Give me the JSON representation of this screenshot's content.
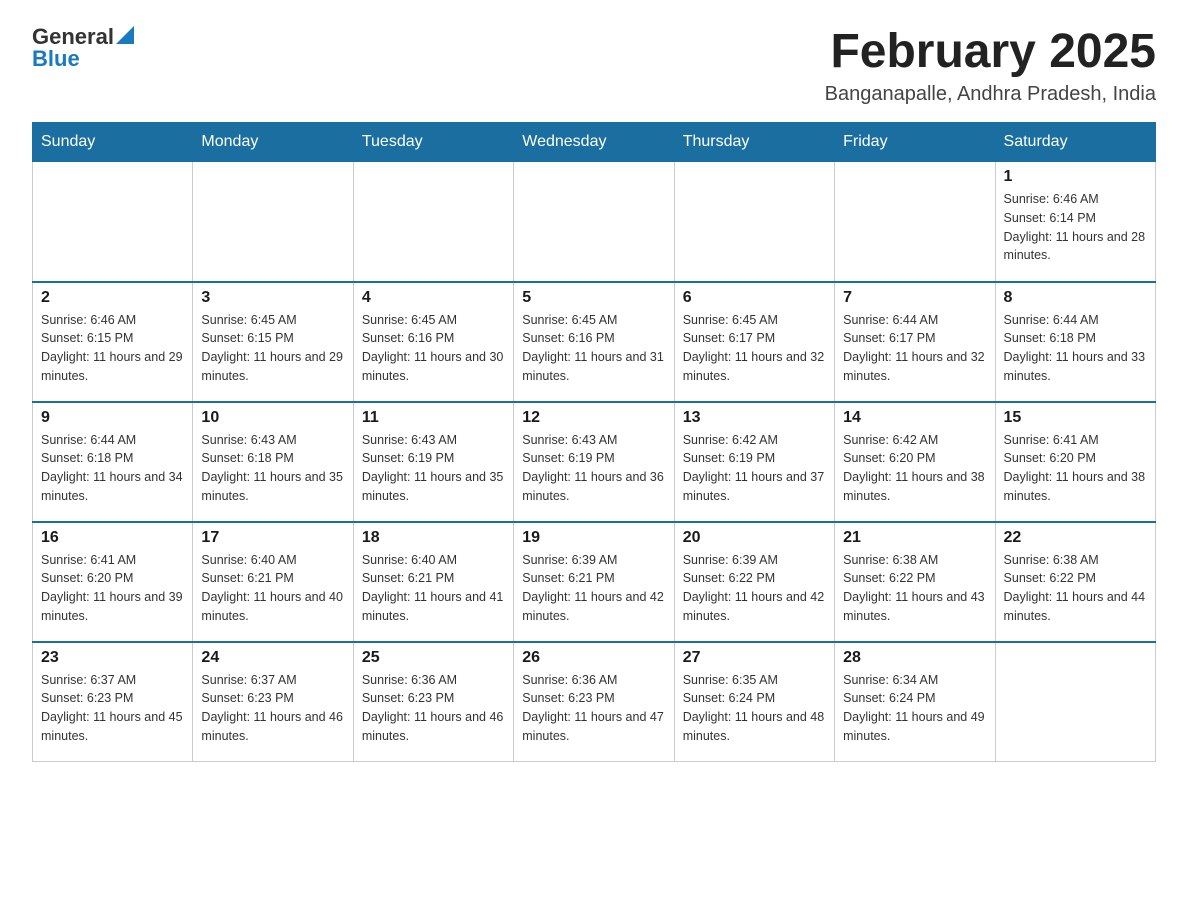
{
  "header": {
    "logo": {
      "general": "General",
      "blue": "Blue"
    },
    "title": "February 2025",
    "subtitle": "Banganapalle, Andhra Pradesh, India"
  },
  "weekdays": [
    "Sunday",
    "Monday",
    "Tuesday",
    "Wednesday",
    "Thursday",
    "Friday",
    "Saturday"
  ],
  "weeks": [
    [
      {
        "day": "",
        "info": ""
      },
      {
        "day": "",
        "info": ""
      },
      {
        "day": "",
        "info": ""
      },
      {
        "day": "",
        "info": ""
      },
      {
        "day": "",
        "info": ""
      },
      {
        "day": "",
        "info": ""
      },
      {
        "day": "1",
        "info": "Sunrise: 6:46 AM\nSunset: 6:14 PM\nDaylight: 11 hours and 28 minutes."
      }
    ],
    [
      {
        "day": "2",
        "info": "Sunrise: 6:46 AM\nSunset: 6:15 PM\nDaylight: 11 hours and 29 minutes."
      },
      {
        "day": "3",
        "info": "Sunrise: 6:45 AM\nSunset: 6:15 PM\nDaylight: 11 hours and 29 minutes."
      },
      {
        "day": "4",
        "info": "Sunrise: 6:45 AM\nSunset: 6:16 PM\nDaylight: 11 hours and 30 minutes."
      },
      {
        "day": "5",
        "info": "Sunrise: 6:45 AM\nSunset: 6:16 PM\nDaylight: 11 hours and 31 minutes."
      },
      {
        "day": "6",
        "info": "Sunrise: 6:45 AM\nSunset: 6:17 PM\nDaylight: 11 hours and 32 minutes."
      },
      {
        "day": "7",
        "info": "Sunrise: 6:44 AM\nSunset: 6:17 PM\nDaylight: 11 hours and 32 minutes."
      },
      {
        "day": "8",
        "info": "Sunrise: 6:44 AM\nSunset: 6:18 PM\nDaylight: 11 hours and 33 minutes."
      }
    ],
    [
      {
        "day": "9",
        "info": "Sunrise: 6:44 AM\nSunset: 6:18 PM\nDaylight: 11 hours and 34 minutes."
      },
      {
        "day": "10",
        "info": "Sunrise: 6:43 AM\nSunset: 6:18 PM\nDaylight: 11 hours and 35 minutes."
      },
      {
        "day": "11",
        "info": "Sunrise: 6:43 AM\nSunset: 6:19 PM\nDaylight: 11 hours and 35 minutes."
      },
      {
        "day": "12",
        "info": "Sunrise: 6:43 AM\nSunset: 6:19 PM\nDaylight: 11 hours and 36 minutes."
      },
      {
        "day": "13",
        "info": "Sunrise: 6:42 AM\nSunset: 6:19 PM\nDaylight: 11 hours and 37 minutes."
      },
      {
        "day": "14",
        "info": "Sunrise: 6:42 AM\nSunset: 6:20 PM\nDaylight: 11 hours and 38 minutes."
      },
      {
        "day": "15",
        "info": "Sunrise: 6:41 AM\nSunset: 6:20 PM\nDaylight: 11 hours and 38 minutes."
      }
    ],
    [
      {
        "day": "16",
        "info": "Sunrise: 6:41 AM\nSunset: 6:20 PM\nDaylight: 11 hours and 39 minutes."
      },
      {
        "day": "17",
        "info": "Sunrise: 6:40 AM\nSunset: 6:21 PM\nDaylight: 11 hours and 40 minutes."
      },
      {
        "day": "18",
        "info": "Sunrise: 6:40 AM\nSunset: 6:21 PM\nDaylight: 11 hours and 41 minutes."
      },
      {
        "day": "19",
        "info": "Sunrise: 6:39 AM\nSunset: 6:21 PM\nDaylight: 11 hours and 42 minutes."
      },
      {
        "day": "20",
        "info": "Sunrise: 6:39 AM\nSunset: 6:22 PM\nDaylight: 11 hours and 42 minutes."
      },
      {
        "day": "21",
        "info": "Sunrise: 6:38 AM\nSunset: 6:22 PM\nDaylight: 11 hours and 43 minutes."
      },
      {
        "day": "22",
        "info": "Sunrise: 6:38 AM\nSunset: 6:22 PM\nDaylight: 11 hours and 44 minutes."
      }
    ],
    [
      {
        "day": "23",
        "info": "Sunrise: 6:37 AM\nSunset: 6:23 PM\nDaylight: 11 hours and 45 minutes."
      },
      {
        "day": "24",
        "info": "Sunrise: 6:37 AM\nSunset: 6:23 PM\nDaylight: 11 hours and 46 minutes."
      },
      {
        "day": "25",
        "info": "Sunrise: 6:36 AM\nSunset: 6:23 PM\nDaylight: 11 hours and 46 minutes."
      },
      {
        "day": "26",
        "info": "Sunrise: 6:36 AM\nSunset: 6:23 PM\nDaylight: 11 hours and 47 minutes."
      },
      {
        "day": "27",
        "info": "Sunrise: 6:35 AM\nSunset: 6:24 PM\nDaylight: 11 hours and 48 minutes."
      },
      {
        "day": "28",
        "info": "Sunrise: 6:34 AM\nSunset: 6:24 PM\nDaylight: 11 hours and 49 minutes."
      },
      {
        "day": "",
        "info": ""
      }
    ]
  ]
}
